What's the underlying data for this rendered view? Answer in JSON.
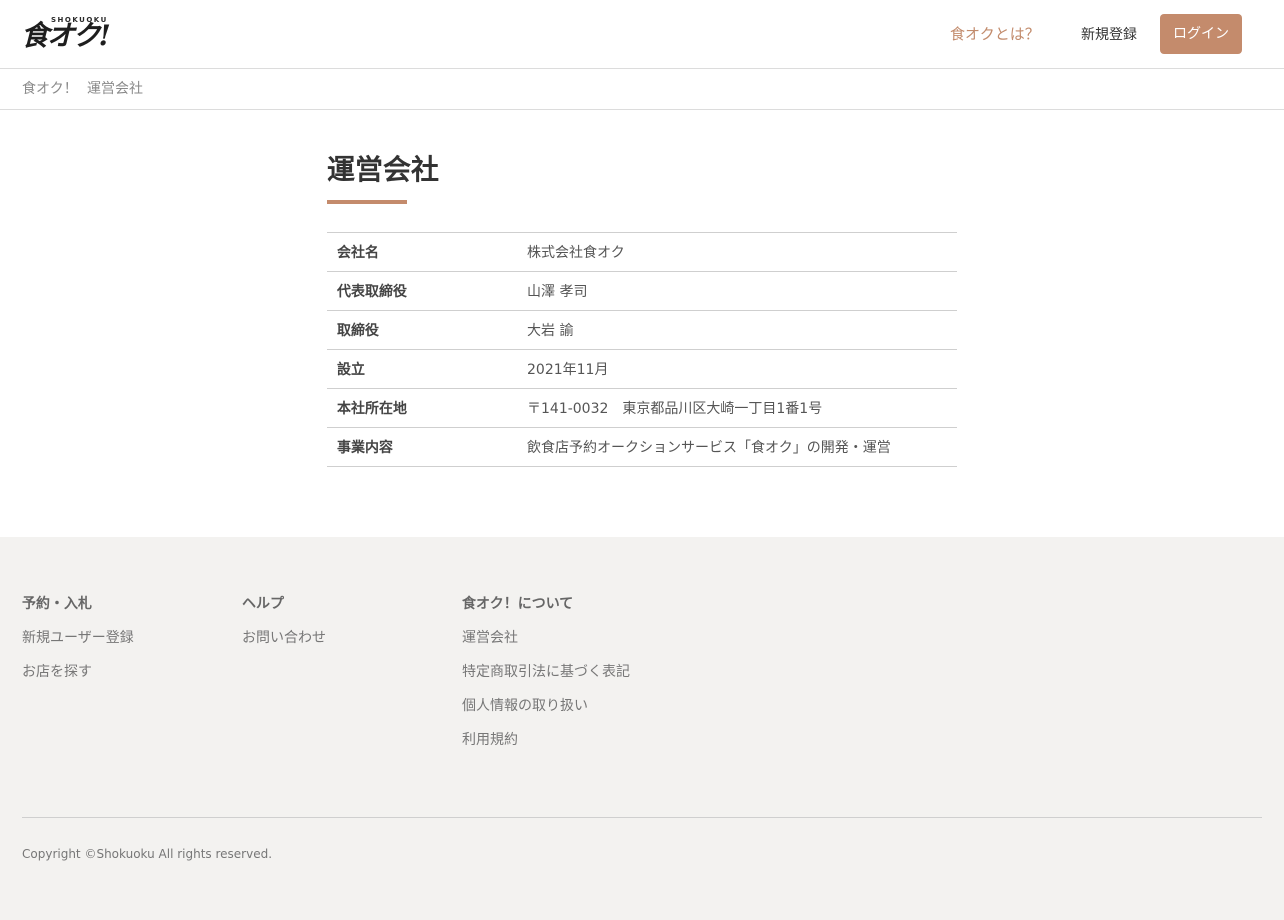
{
  "header": {
    "logo_small": "SHOKUOKU",
    "logo_main": "食オク!",
    "nav_about": "食オクとは？",
    "nav_signup": "新規登録",
    "nav_login": "ログイン"
  },
  "breadcrumb": {
    "home": "食オク！",
    "current": "運営会社"
  },
  "main": {
    "title": "運営会社",
    "rows": [
      {
        "label": "会社名",
        "value": "株式会社食オク"
      },
      {
        "label": "代表取締役",
        "value": "山澤 孝司"
      },
      {
        "label": "取締役",
        "value": "大岩 諭"
      },
      {
        "label": "設立",
        "value": "2021年11月"
      },
      {
        "label": "本社所在地",
        "value": "〒141-0032　東京都品川区大崎一丁目1番1号"
      },
      {
        "label": "事業内容",
        "value": "飲食店予約オークションサービス「食オク」の開発・運営"
      }
    ]
  },
  "footer": {
    "col1": {
      "heading": "予約・入札",
      "links": [
        "新規ユーザー登録",
        "お店を探す"
      ]
    },
    "col2": {
      "heading": "ヘルプ",
      "links": [
        "お問い合わせ"
      ]
    },
    "col3": {
      "heading": "食オク！について",
      "links": [
        "運営会社",
        "特定商取引法に基づく表記",
        "個人情報の取り扱い",
        "利用規約"
      ]
    },
    "copyright": "Copyright ©Shokuoku All rights reserved."
  },
  "colors": {
    "accent": "#c48b6c",
    "footer_bg": "#f3f2f0"
  }
}
